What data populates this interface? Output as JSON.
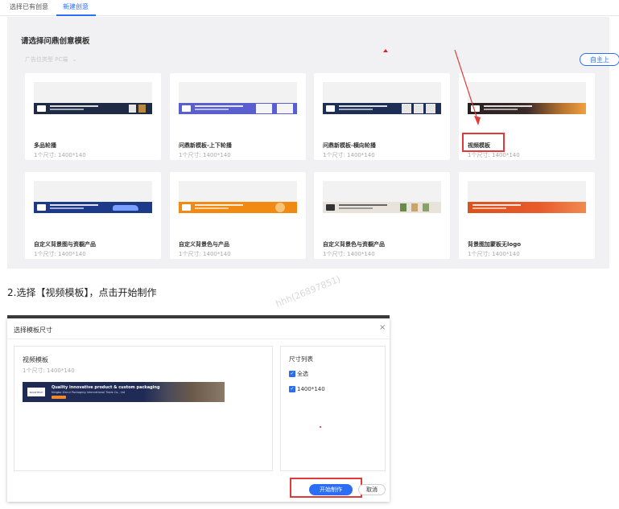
{
  "tabs": [
    {
      "label": "选择已有创意"
    },
    {
      "label": "新建创意",
      "active": true
    }
  ],
  "panel": {
    "title": "请选择问鼎创意模板",
    "filter": "广告位类型  PC端",
    "custom_button": "自主上"
  },
  "templates": [
    {
      "name": "多品轮播",
      "size": "1个尺寸: 1400*140",
      "banner_color": "#1f2a44"
    },
    {
      "name": "问鼎新模板-上下轮播",
      "size": "1个尺寸: 1400*140",
      "banner_color": "#5a5fcf"
    },
    {
      "name": "问鼎新模板-横向轮播",
      "size": "1个尺寸: 1400*140",
      "banner_color": "#1e2f55"
    },
    {
      "name": "视频模板",
      "size": "1个尺寸: 1400*140",
      "banner_color": "#3a2a2a"
    },
    {
      "name": "自定义背景图与资橱产品",
      "size": "1个尺寸: 1400*140",
      "banner_color": "#1d3a8a"
    },
    {
      "name": "自定义背景色与产品",
      "size": "1个尺寸: 1400*140",
      "banner_color": "#f08a12"
    },
    {
      "name": "自定义背景色与资橱产品",
      "size": "1个尺寸: 1400*140",
      "banner_color": "#e8e4dc"
    },
    {
      "name": "背景图加蒙板无logo",
      "size": "1个尺寸: 1400*140",
      "banner_color": "#e85a2a"
    }
  ],
  "instruction": "2.选择【视频模板】，点击开始制作",
  "watermark": "hhh(26897851)",
  "dialog": {
    "title": "选择模板尺寸",
    "close_icon": "×",
    "template_name": "视频模板",
    "template_size": "1个尺寸: 1400*140",
    "banner_heading": "Quality innovative product & custom packaging",
    "banner_sub": "Ningbo Xinrui Packaging International Trade Co., Ltd",
    "banner_logo": "NUOXTECH",
    "size_list_title": "尺寸列表",
    "select_all": "全选",
    "size_option": "1400*140",
    "start_button": "开始制作",
    "cancel_button": "取消"
  },
  "colors": {
    "accent": "#2b6df5",
    "highlight": "#e23a3a"
  }
}
